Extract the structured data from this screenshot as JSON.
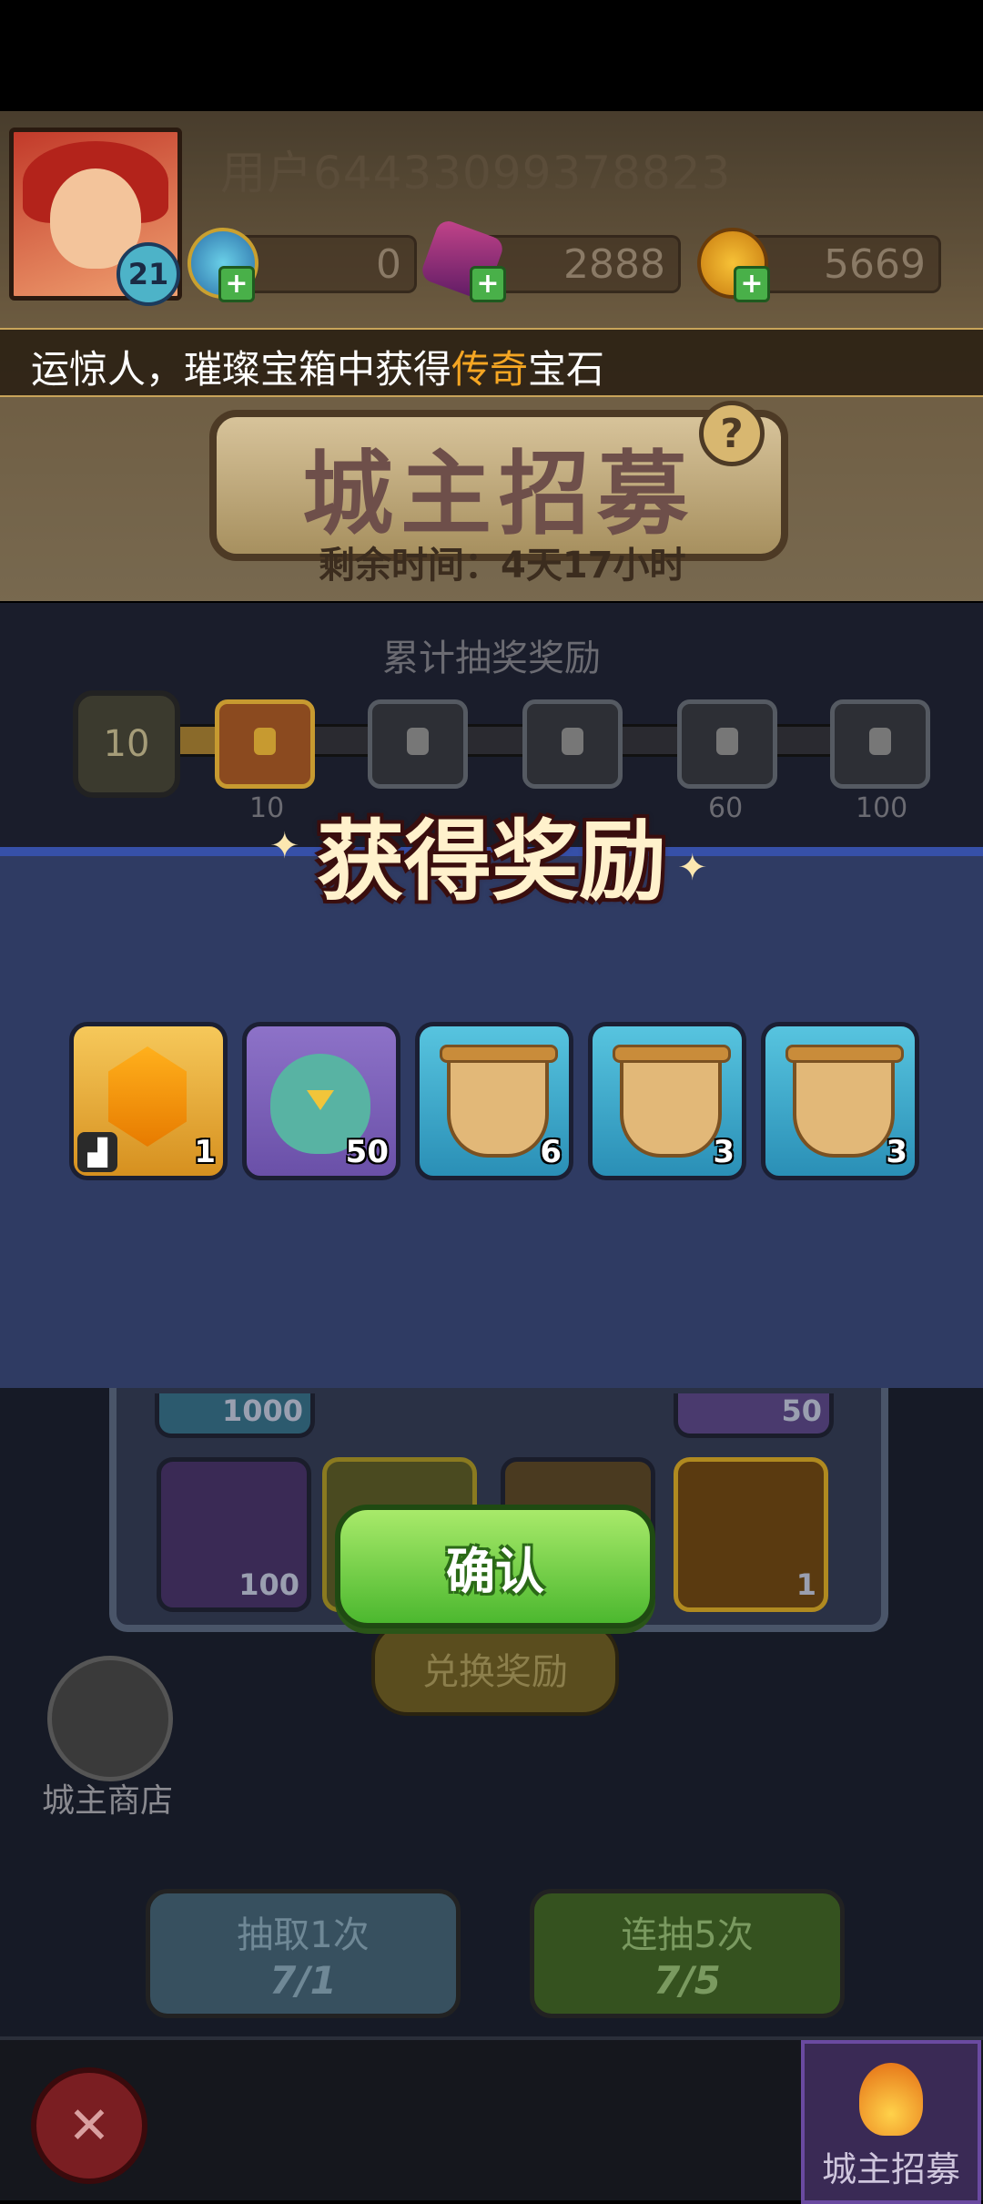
{
  "header": {
    "username": "用户64433099378823",
    "level": "21",
    "currencies": [
      {
        "name": "blue-gem",
        "value": "0"
      },
      {
        "name": "purple-gem",
        "value": "2888"
      },
      {
        "name": "gold-coin",
        "value": "5669"
      }
    ],
    "ticker": {
      "prefix": "运惊人，璀璨宝箱中获得",
      "highlight": "传奇",
      "suffix": "宝石"
    },
    "banner_title": "城主招募",
    "help": "?",
    "timer": "剩余时间：4天17小时"
  },
  "progress": {
    "title": "累计抽奖奖励",
    "medal_value": "10",
    "milestones": [
      "10",
      "",
      "",
      "60",
      "100"
    ]
  },
  "modal": {
    "title": "获得奖励",
    "rewards": [
      {
        "type": "gem",
        "qty": "1"
      },
      {
        "type": "owl",
        "qty": "50"
      },
      {
        "type": "armor-scroll",
        "qty": "6"
      },
      {
        "type": "ring-scroll",
        "qty": "3"
      },
      {
        "type": "boot-scroll",
        "qty": "3"
      }
    ],
    "confirm": "确认"
  },
  "lower": {
    "cells": [
      "1000",
      "50",
      "100",
      "",
      "",
      "1"
    ],
    "exchange": "兑换奖励",
    "shop_label": "城主商店",
    "draw_once": {
      "label": "抽取1次",
      "count": "7/1"
    },
    "draw_five": {
      "label": "连抽5次",
      "count": "7/5"
    }
  },
  "bottom": {
    "tab_label": "城主招募"
  },
  "colors": {
    "accent_green": "#4cb82f",
    "modal_blue": "#2f3b63",
    "highlight_orange": "#f5a623"
  }
}
